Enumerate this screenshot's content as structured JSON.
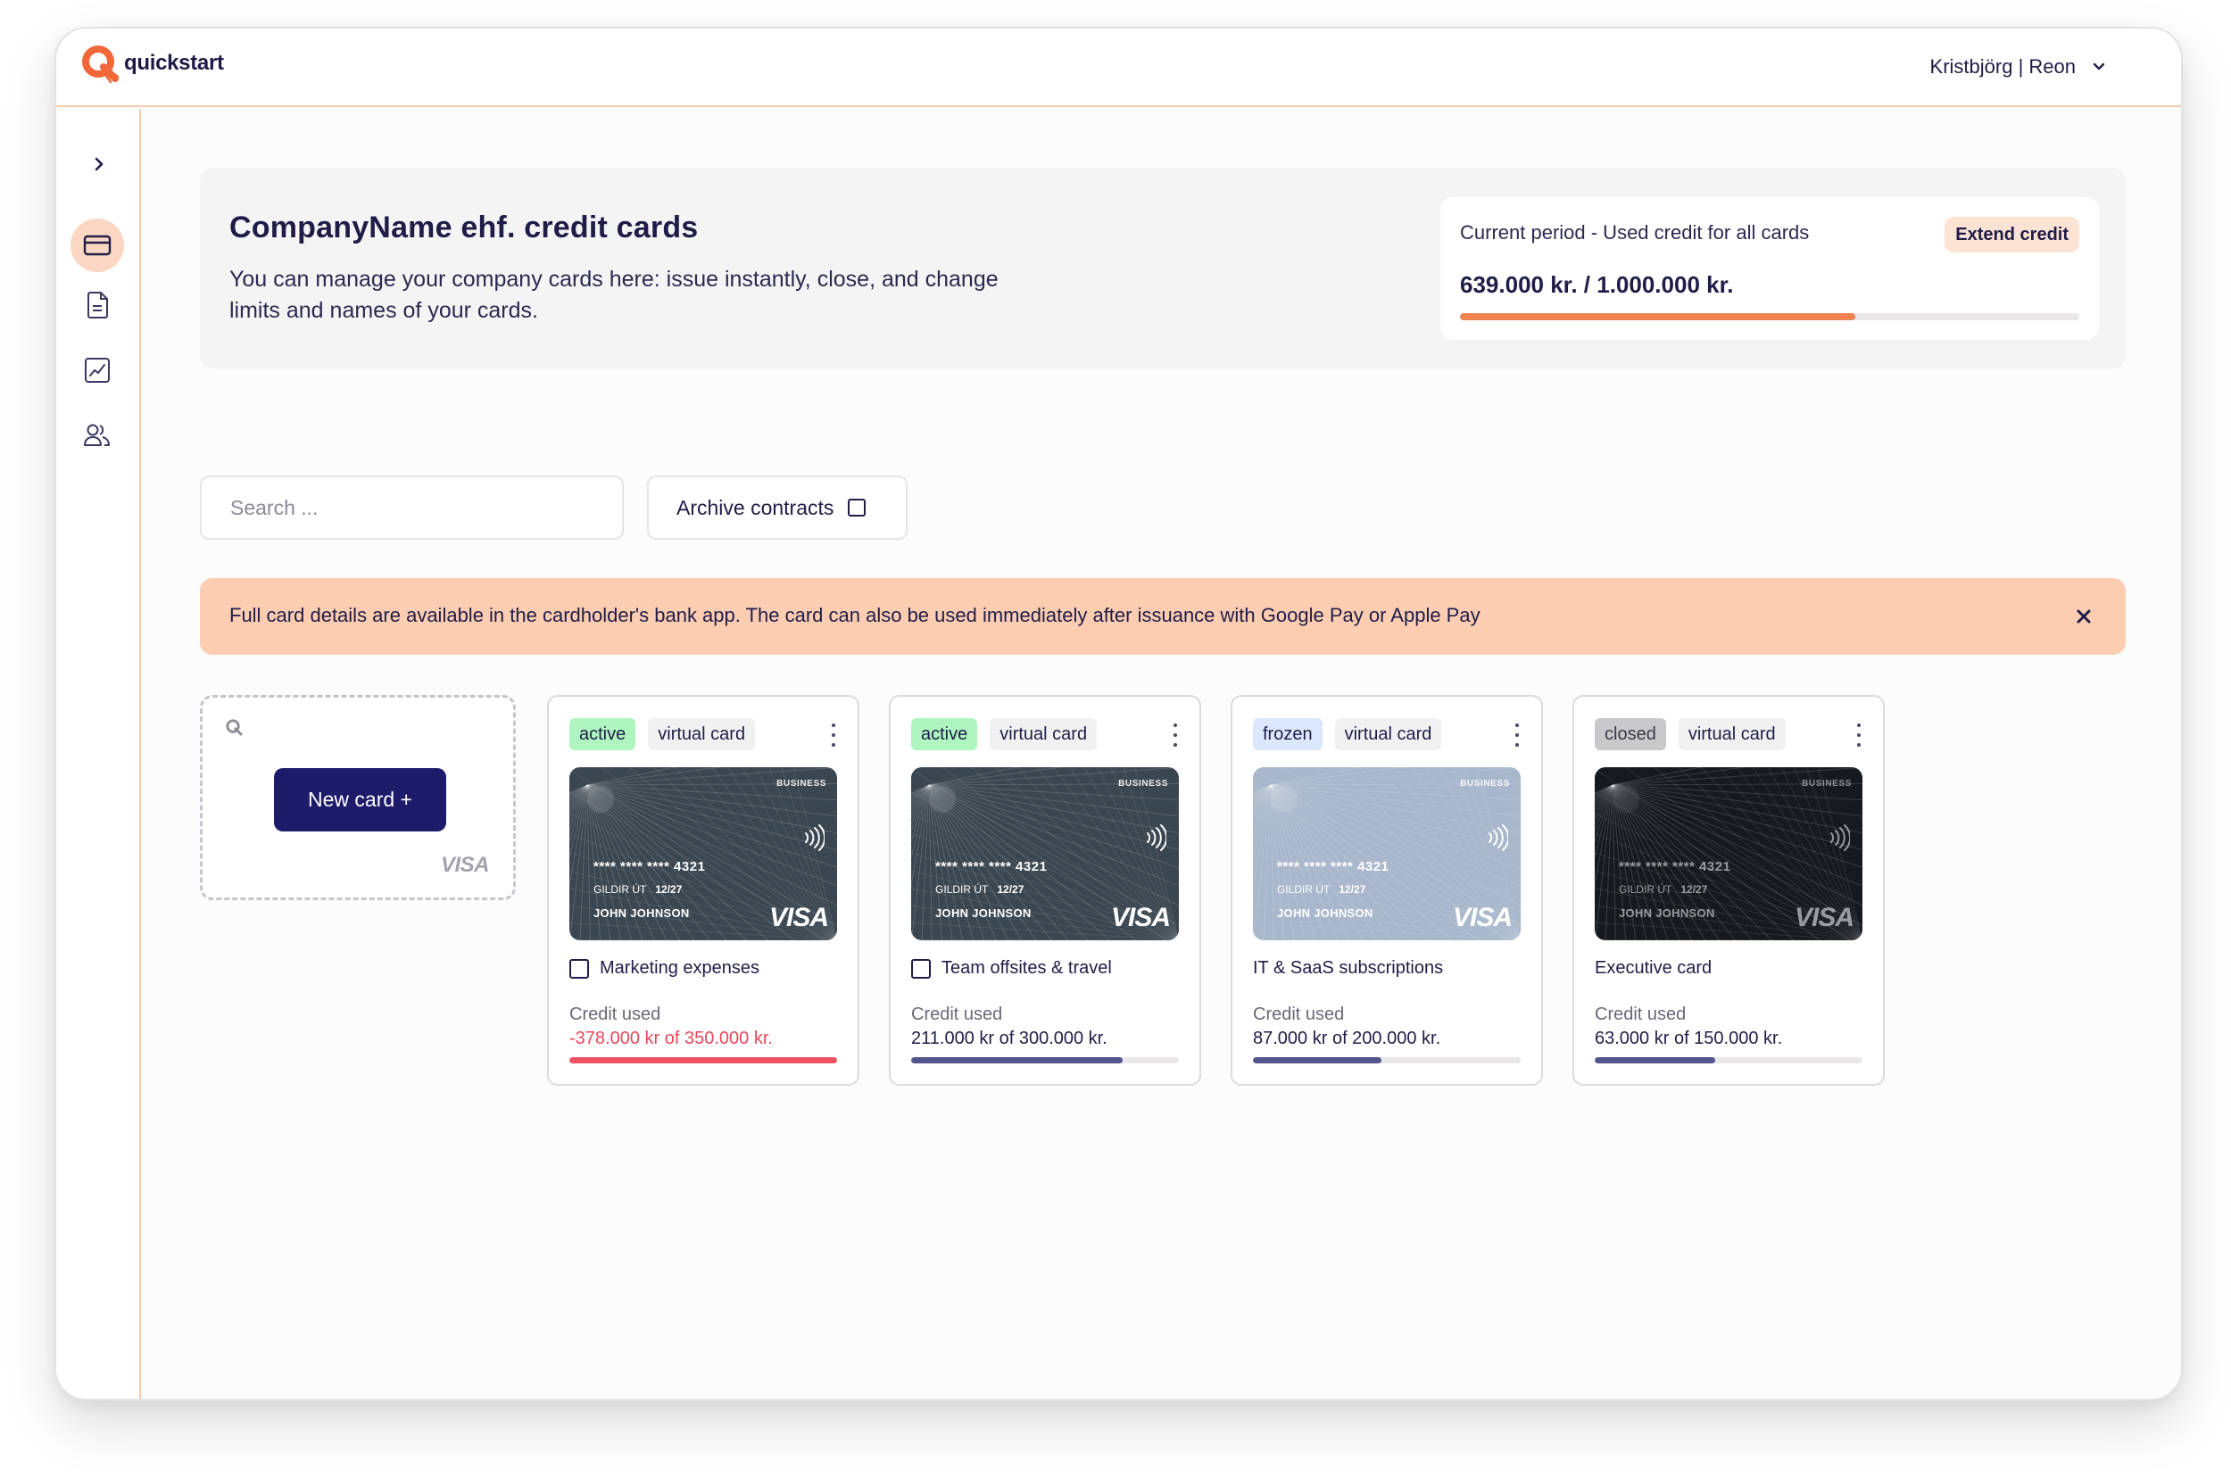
{
  "app": {
    "name": "quickstart",
    "user": "Kristbjörg | Reon"
  },
  "sidebar": {
    "toggle_icon": "chevron-right-icon",
    "items": [
      {
        "icon": "credit-card-icon",
        "active": true
      },
      {
        "icon": "document-icon",
        "active": false
      },
      {
        "icon": "chart-icon",
        "active": false
      },
      {
        "icon": "users-icon",
        "active": false
      }
    ]
  },
  "hero": {
    "title": "CompanyName ehf. credit cards",
    "description": "You can manage your company cards here: issue instantly, close, and change limits and names of your cards.",
    "credit": {
      "label": "Current period - Used credit for all cards",
      "extend_label": "Extend credit",
      "value": "639.000 kr. / 1.000.000 kr.",
      "fraction": 0.639
    }
  },
  "toolbar": {
    "search_placeholder": "Search ...",
    "archive_label": "Archive contracts"
  },
  "notice": {
    "text": "Full card details are available in the cardholder's bank app. The card can also be used immediately after issuance with Google Pay or Apple Pay"
  },
  "new_card": {
    "button_label": "New card +",
    "brand": "VISA"
  },
  "card_face": {
    "business": "BUSINESS",
    "number": "**** **** **** 4321",
    "exp_label": "GILDIR ÚT",
    "exp": "12/27",
    "holder": "JOHN JOHNSON",
    "brand": "VISA"
  },
  "cards": [
    {
      "status": "active",
      "type": "virtual card",
      "name": "Marketing expenses",
      "has_checkbox": true,
      "credit_label": "Credit used",
      "credit_text": "-378.000 kr of 350.000 kr.",
      "fraction": 1.0,
      "over": true,
      "status_bg": "#aef5c0",
      "status_color": "#1f1d48",
      "card_bg": "#3a4650",
      "card_opacity": 1
    },
    {
      "status": "active",
      "type": "virtual card",
      "name": "Team offsites & travel",
      "has_checkbox": true,
      "credit_label": "Credit used",
      "credit_text": "211.000 kr of 300.000 kr.",
      "fraction": 0.79,
      "over": false,
      "status_bg": "#aef5c0",
      "status_color": "#1f1d48",
      "card_bg": "#3a4650",
      "card_opacity": 1
    },
    {
      "status": "frozen",
      "type": "virtual card",
      "name": "IT & SaaS subscriptions",
      "has_checkbox": false,
      "credit_label": "Credit used",
      "credit_text": "87.000 kr of 200.000 kr.",
      "fraction": 0.48,
      "over": false,
      "status_bg": "#dbe8fb",
      "status_color": "#1f1d48",
      "card_bg": "#a8b7cb",
      "card_opacity": 1
    },
    {
      "status": "closed",
      "type": "virtual card",
      "name": "Executive card",
      "has_checkbox": false,
      "credit_label": "Credit used",
      "credit_text": "63.000 kr of 150.000 kr.",
      "fraction": 0.45,
      "over": false,
      "status_bg": "#c9c8cb",
      "status_color": "#3a3948",
      "card_bg": "#141a1e",
      "card_opacity": 0.55
    }
  ]
}
